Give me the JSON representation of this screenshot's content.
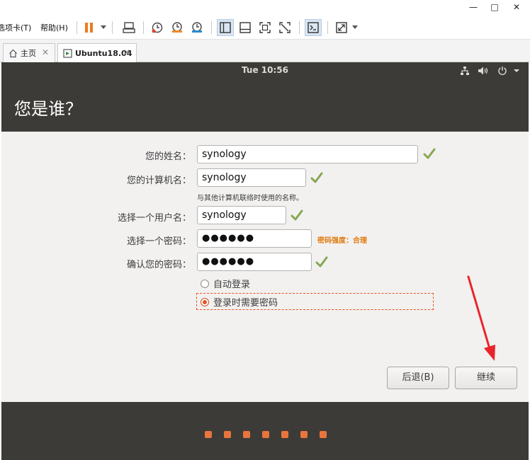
{
  "window": {
    "minimize_glyph": "—",
    "maximize_glyph": "□",
    "close_glyph": "✕"
  },
  "menubar": {
    "tabs_menu": "选项卡(T)",
    "help_menu": "帮助(H)"
  },
  "tabs": [
    {
      "label": "主页",
      "icon": "home-icon",
      "active": false
    },
    {
      "label": "Ubuntu18.04",
      "icon": "vm-icon",
      "active": true
    }
  ],
  "vm": {
    "topbar": {
      "clock": "Tue 10:56"
    },
    "header": {
      "title": "您是谁？"
    },
    "form": {
      "name_label": "您的姓名：",
      "name_value": "synology",
      "computer_label": "您的计算机名：",
      "computer_value": "synology",
      "computer_hint": "与其他计算机联络时使用的名称。",
      "username_label": "选择一个用户名：",
      "username_value": "synology",
      "password_label": "选择一个密码：",
      "password_value": "●●●●●●",
      "password_strength": "密码强度：合理",
      "confirm_label": "确认您的密码：",
      "confirm_value": "●●●●●●",
      "auto_login_label": "自动登录",
      "require_password_label": "登录时需要密码",
      "selected_option": "require_password"
    },
    "buttons": {
      "back": "后退(B)",
      "continue": "继续"
    },
    "progress": {
      "total_steps": 7
    }
  },
  "colors": {
    "ubuntu_orange": "#e95420",
    "check_green": "#87a752",
    "strength_orange": "#e07b10",
    "annotation_arrow": "#e8252a"
  }
}
